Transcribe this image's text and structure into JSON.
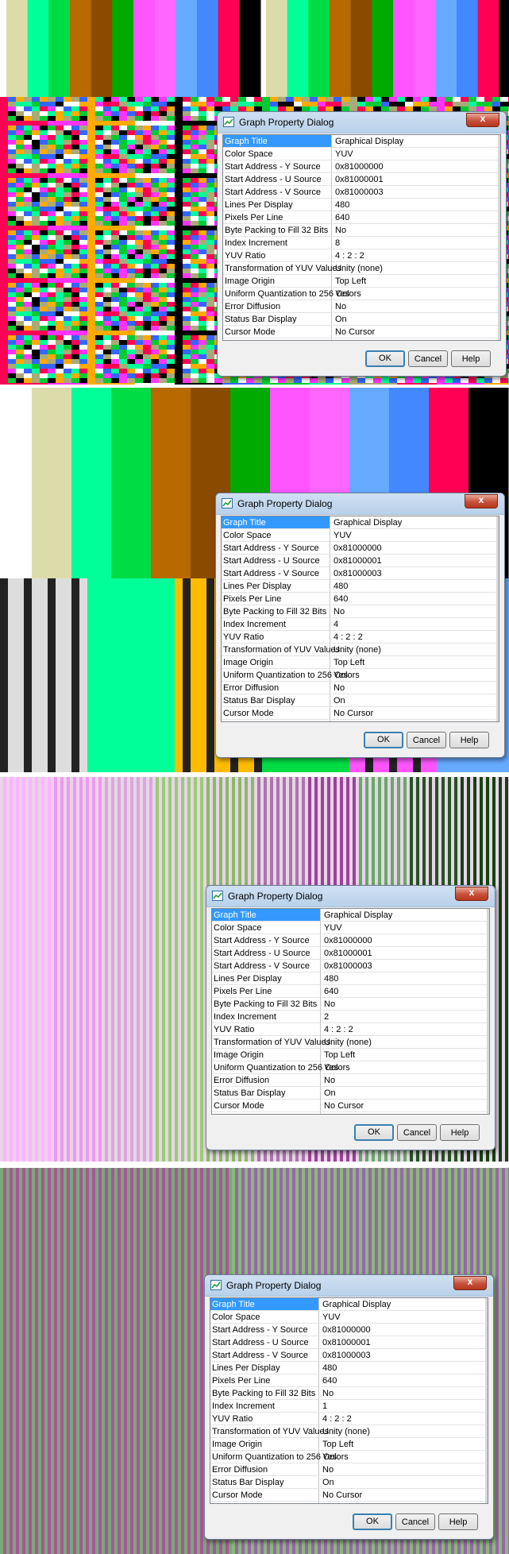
{
  "dialog": {
    "title": "Graph Property Dialog",
    "close_label": "x",
    "properties": [
      {
        "key": "Graph Title",
        "value": "Graphical Display"
      },
      {
        "key": "Color Space",
        "value": "YUV"
      },
      {
        "key": "Start Address - Y Source",
        "value": "0x81000000"
      },
      {
        "key": "Start Address - U Source",
        "value": "0x81000001"
      },
      {
        "key": "Start Address - V Source",
        "value": "0x81000003"
      },
      {
        "key": "Lines Per Display",
        "value": "480"
      },
      {
        "key": "Pixels Per Line",
        "value": "640"
      },
      {
        "key": "Byte Packing to Fill 32 Bits",
        "value": "No"
      },
      {
        "key": "Index Increment",
        "value": ""
      },
      {
        "key": "YUV Ratio",
        "value": "4 : 2 : 2"
      },
      {
        "key": "Transformation of YUV Values",
        "value": "Unity (none)"
      },
      {
        "key": "Image Origin",
        "value": "Top Left"
      },
      {
        "key": "Uniform Quantization to 256 Colors",
        "value": "Yes"
      },
      {
        "key": "Error Diffusion",
        "value": "No"
      },
      {
        "key": "Status Bar Display",
        "value": "On"
      },
      {
        "key": "Cursor Mode",
        "value": "No Cursor"
      }
    ],
    "buttons": {
      "ok": "OK",
      "cancel": "Cancel",
      "help": "Help"
    }
  },
  "panels": [
    {
      "index_increment": "8"
    },
    {
      "index_increment": "4"
    },
    {
      "index_increment": "2"
    },
    {
      "index_increment": "1"
    }
  ],
  "colors": {
    "selection": "#3399ff",
    "titlebar": "#c4d8ee",
    "close": "#c7503a",
    "bars": [
      "#dcdcaa",
      "#00ff99",
      "#00dd44",
      "#b86a00",
      "#8a4a00",
      "#00aa00",
      "#ff55ff",
      "#ff66ff",
      "#66aaff",
      "#4488ff",
      "#ff0055",
      "#000000"
    ]
  }
}
